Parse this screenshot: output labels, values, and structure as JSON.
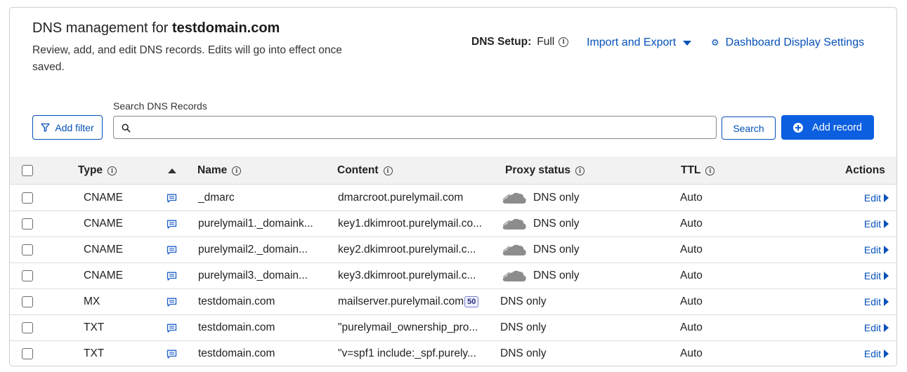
{
  "header": {
    "title_prefix": "DNS management for ",
    "domain": "testdomain.com",
    "description": "Review, add, and edit DNS records. Edits will go into effect once saved.",
    "dns_setup_label": "DNS Setup:",
    "dns_setup_value": "Full",
    "import_export_label": "Import and Export",
    "dashboard_settings_label": "Dashboard Display Settings"
  },
  "toolbar": {
    "add_filter_label": "Add filter",
    "search_label": "Search DNS Records",
    "search_value": "",
    "search_button_label": "Search",
    "add_record_label": "Add record"
  },
  "table": {
    "columns": {
      "type": "Type",
      "name": "Name",
      "content": "Content",
      "proxy": "Proxy status",
      "ttl": "TTL",
      "actions": "Actions"
    },
    "sort": "Name ascending",
    "edit_label": "Edit",
    "rows": [
      {
        "type": "CNAME",
        "name": "_dmarc",
        "content": "dmarcroot.purelymail.com",
        "proxy": "DNS only",
        "proxy_icon": true,
        "priority": "",
        "ttl": "Auto"
      },
      {
        "type": "CNAME",
        "name": "purelymail1._domaink...",
        "content": "key1.dkimroot.purelymail.co...",
        "proxy": "DNS only",
        "proxy_icon": true,
        "priority": "",
        "ttl": "Auto"
      },
      {
        "type": "CNAME",
        "name": "purelymail2._domain...",
        "content": "key2.dkimroot.purelymail.c...",
        "proxy": "DNS only",
        "proxy_icon": true,
        "priority": "",
        "ttl": "Auto"
      },
      {
        "type": "CNAME",
        "name": "purelymail3._domain...",
        "content": "key3.dkimroot.purelymail.c...",
        "proxy": "DNS only",
        "proxy_icon": true,
        "priority": "",
        "ttl": "Auto"
      },
      {
        "type": "MX",
        "name": "testdomain.com",
        "content": "mailserver.purelymail.com",
        "proxy": "DNS only",
        "proxy_icon": false,
        "priority": "50",
        "ttl": "Auto"
      },
      {
        "type": "TXT",
        "name": "testdomain.com",
        "content": "\"purelymail_ownership_pro...",
        "proxy": "DNS only",
        "proxy_icon": false,
        "priority": "",
        "ttl": "Auto"
      },
      {
        "type": "TXT",
        "name": "testdomain.com",
        "content": "\"v=spf1 include:_spf.purely...",
        "proxy": "DNS only",
        "proxy_icon": false,
        "priority": "",
        "ttl": "Auto"
      }
    ]
  },
  "colors": {
    "accent": "#0551b8",
    "primary_button": "#0b5fe0",
    "header_bg": "#f2f2f2"
  }
}
